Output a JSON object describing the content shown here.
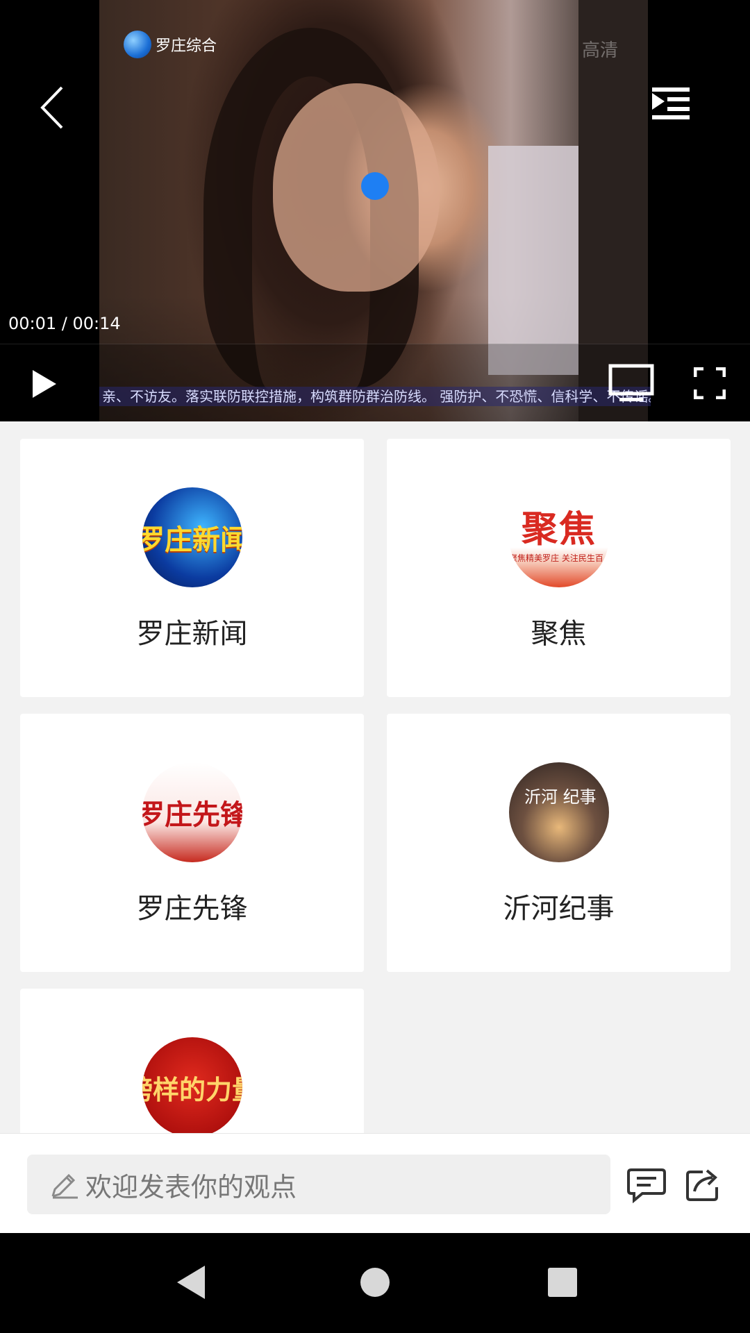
{
  "player": {
    "channel_logo_text": "罗庄综合",
    "quality_mark": "高清",
    "time_current": "00:01",
    "time_total": "00:14",
    "time_separator": " / ",
    "ticker_text": "亲、不访友。落实联防联控措施，构筑群防群治防线。  强防护、不恐慌、信科学、不传谣。  关",
    "icons": {
      "back": "chevron-left-icon",
      "playlist": "playlist-play-icon",
      "play": "play-icon",
      "tv": "tv-cast-icon",
      "fullscreen": "fullscreen-icon"
    }
  },
  "programs": [
    {
      "title": "罗庄新闻",
      "thumb_text": "罗庄新闻",
      "thumb_sub": ""
    },
    {
      "title": "聚焦",
      "thumb_text": "聚焦",
      "thumb_sub": "聚焦精美罗庄 关注民生百事"
    },
    {
      "title": "罗庄先锋",
      "thumb_text": "罗庄先锋",
      "thumb_sub": ""
    },
    {
      "title": "沂河纪事",
      "thumb_text": "沂河 纪事",
      "thumb_sub": ""
    },
    {
      "title": "",
      "thumb_text": "榜样的力量",
      "thumb_sub": ""
    }
  ],
  "comment_bar": {
    "placeholder": "欢迎发表你的观点",
    "icons": {
      "edit": "pencil-icon",
      "comments": "comment-icon",
      "share": "share-icon"
    }
  },
  "nav_bar": {
    "icons": {
      "back": "nav-back-icon",
      "home": "nav-home-icon",
      "recent": "nav-recent-icon"
    }
  },
  "colors": {
    "accent_blue": "#1e7ff3",
    "page_bg": "#f2f2f2",
    "card_bg": "#ffffff"
  }
}
